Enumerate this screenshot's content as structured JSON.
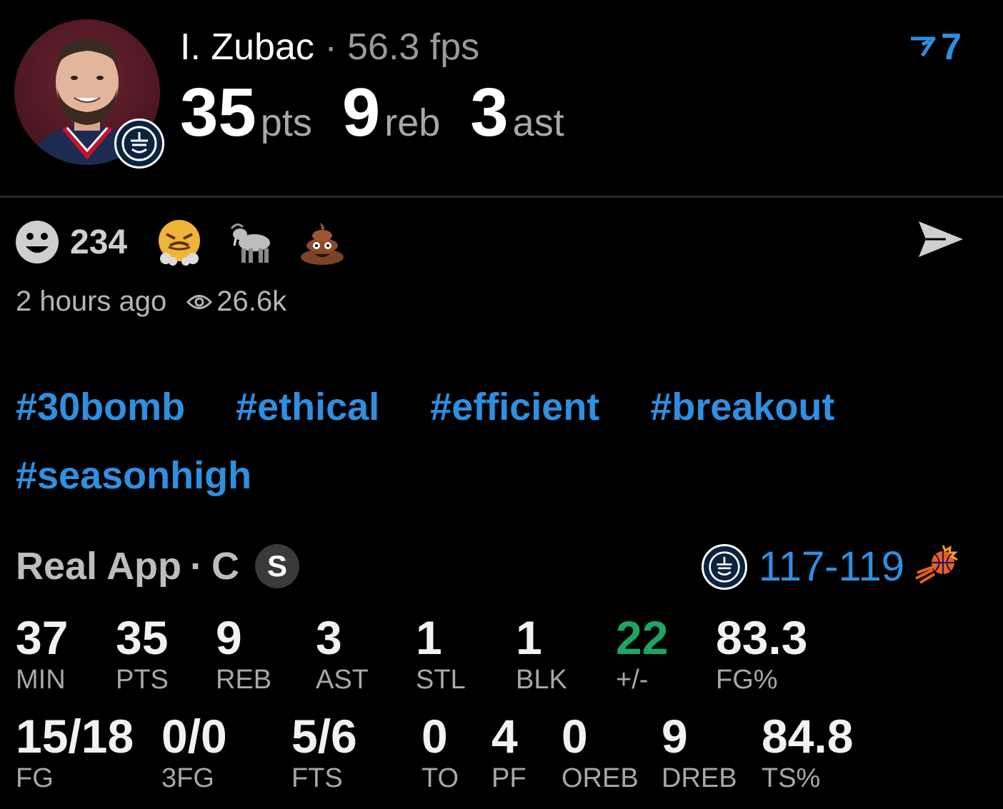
{
  "header": {
    "player_name": "I. Zubac",
    "separator": "·",
    "fps": "56.3 fps",
    "pts_value": "35",
    "pts_unit": "pts",
    "reb_value": "9",
    "reb_unit": "reb",
    "ast_value": "3",
    "ast_unit": "ast",
    "vote_count": "7",
    "accent_color": "#2f8fe0"
  },
  "reactions": {
    "smile_count": "234",
    "icons": [
      "smiley-icon",
      "angry-emoji-icon",
      "goat-emoji-icon",
      "poop-emoji-icon",
      "share-icon"
    ]
  },
  "meta": {
    "time": "2 hours ago",
    "views": "26.6k"
  },
  "tags": [
    "#30bomb",
    "#ethical",
    "#efficient",
    "#breakout",
    "#seasonhigh"
  ],
  "game": {
    "app": "Real App",
    "separator": "·",
    "position": "C",
    "badge": "S",
    "score": "117-119",
    "positive_color": "#1da562"
  },
  "stats_row1": [
    {
      "value": "37",
      "label": "MIN"
    },
    {
      "value": "35",
      "label": "PTS"
    },
    {
      "value": "9",
      "label": "REB"
    },
    {
      "value": "3",
      "label": "AST"
    },
    {
      "value": "1",
      "label": "STL"
    },
    {
      "value": "1",
      "label": "BLK"
    },
    {
      "value": "22",
      "label": "+/-"
    },
    {
      "value": "83.3",
      "label": "FG%"
    }
  ],
  "stats_row2": [
    {
      "value": "15/18",
      "label": "FG"
    },
    {
      "value": "0/0",
      "label": "3FG"
    },
    {
      "value": "5/6",
      "label": "FTS"
    },
    {
      "value": "0",
      "label": "TO"
    },
    {
      "value": "4",
      "label": "PF"
    },
    {
      "value": "0",
      "label": "OREB"
    },
    {
      "value": "9",
      "label": "DREB"
    },
    {
      "value": "84.8",
      "label": "TS%"
    }
  ]
}
